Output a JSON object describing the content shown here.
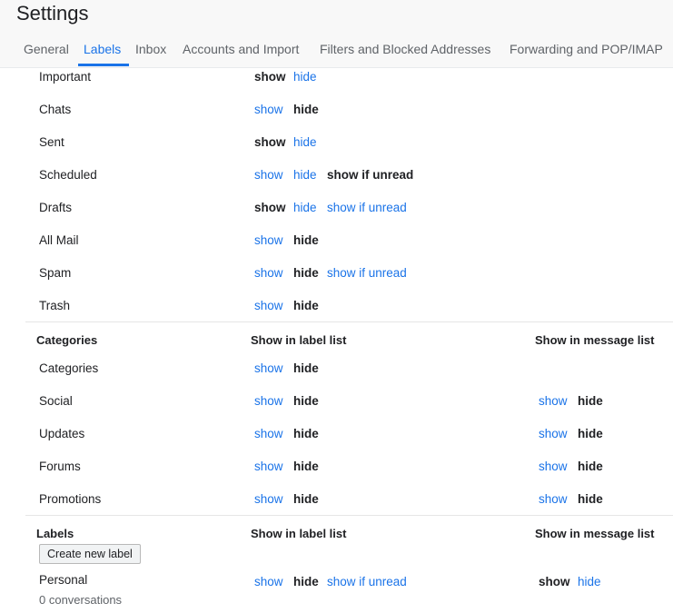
{
  "title": "Settings",
  "tabs": [
    "General",
    "Labels",
    "Inbox",
    "Accounts and Import",
    "Filters and Blocked Addresses",
    "Forwarding and POP/IMAP"
  ],
  "active_tab": "Labels",
  "system_labels": [
    {
      "name": "Important",
      "opts": [
        "show",
        "hide"
      ],
      "selected": "show"
    },
    {
      "name": "Chats",
      "opts": [
        "show",
        "hide"
      ],
      "selected": "hide"
    },
    {
      "name": "Sent",
      "opts": [
        "show",
        "hide"
      ],
      "selected": "show"
    },
    {
      "name": "Scheduled",
      "opts": [
        "show",
        "hide",
        "show if unread"
      ],
      "selected": "show if unread"
    },
    {
      "name": "Drafts",
      "opts": [
        "show",
        "hide",
        "show if unread"
      ],
      "selected": "show"
    },
    {
      "name": "All Mail",
      "opts": [
        "show",
        "hide"
      ],
      "selected": "hide"
    },
    {
      "name": "Spam",
      "opts": [
        "show",
        "hide",
        "show if unread"
      ],
      "selected": "hide"
    },
    {
      "name": "Trash",
      "opts": [
        "show",
        "hide"
      ],
      "selected": "hide"
    }
  ],
  "categories": {
    "title": "Categories",
    "col_label_list": "Show in label list",
    "col_message_list": "Show in message list",
    "rows": [
      {
        "name": "Categories",
        "label_opts": [
          "show",
          "hide"
        ],
        "label_selected": "hide"
      },
      {
        "name": "Social",
        "label_opts": [
          "show",
          "hide"
        ],
        "label_selected": "hide",
        "msg_opts": [
          "show",
          "hide"
        ],
        "msg_selected": "hide"
      },
      {
        "name": "Updates",
        "label_opts": [
          "show",
          "hide"
        ],
        "label_selected": "hide",
        "msg_opts": [
          "show",
          "hide"
        ],
        "msg_selected": "hide"
      },
      {
        "name": "Forums",
        "label_opts": [
          "show",
          "hide"
        ],
        "label_selected": "hide",
        "msg_opts": [
          "show",
          "hide"
        ],
        "msg_selected": "hide"
      },
      {
        "name": "Promotions",
        "label_opts": [
          "show",
          "hide"
        ],
        "label_selected": "hide",
        "msg_opts": [
          "show",
          "hide"
        ],
        "msg_selected": "hide"
      }
    ]
  },
  "labels": {
    "title": "Labels",
    "col_label_list": "Show in label list",
    "col_message_list": "Show in message list",
    "create_button": "Create new label",
    "rows": [
      {
        "name": "Personal",
        "count": "0 conversations",
        "label_opts": [
          "show",
          "hide",
          "show if unread"
        ],
        "label_selected": "hide",
        "msg_opts": [
          "show",
          "hide"
        ],
        "msg_selected": "show"
      }
    ]
  },
  "colors": {
    "link": "#1a73e8",
    "text": "#202124",
    "header_bg": "#f8f8f8"
  }
}
